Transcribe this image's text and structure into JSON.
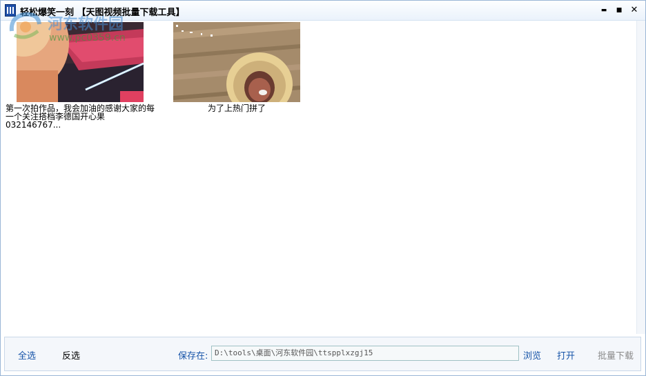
{
  "window": {
    "title": "轻松爆笑一刻 【天图视频批量下载工具】",
    "controls": {
      "minimize": "▬",
      "maximize": "■",
      "close": "✕"
    }
  },
  "watermark": {
    "name": "河东软件园",
    "url": "www.pc0359.cn"
  },
  "videos": [
    {
      "caption": "第一次拍作品，我会加油的感谢大家的每一个关注搭档李德国开心果032146767..."
    },
    {
      "caption": "为了上热门拼了"
    }
  ],
  "bottom": {
    "select_all": "全选",
    "invert_select": "反选",
    "save_label": "保存在:",
    "save_path": "D:\\tools\\桌面\\河东软件园\\ttspplxzgj15",
    "browse": "浏览",
    "open": "打开",
    "batch_download": "批量下载"
  },
  "colors": {
    "link": "#1553a8",
    "disabled": "#8a8a8a",
    "title_bg": "#eaf2fb",
    "bottom_bg": "#f4f7fb"
  }
}
